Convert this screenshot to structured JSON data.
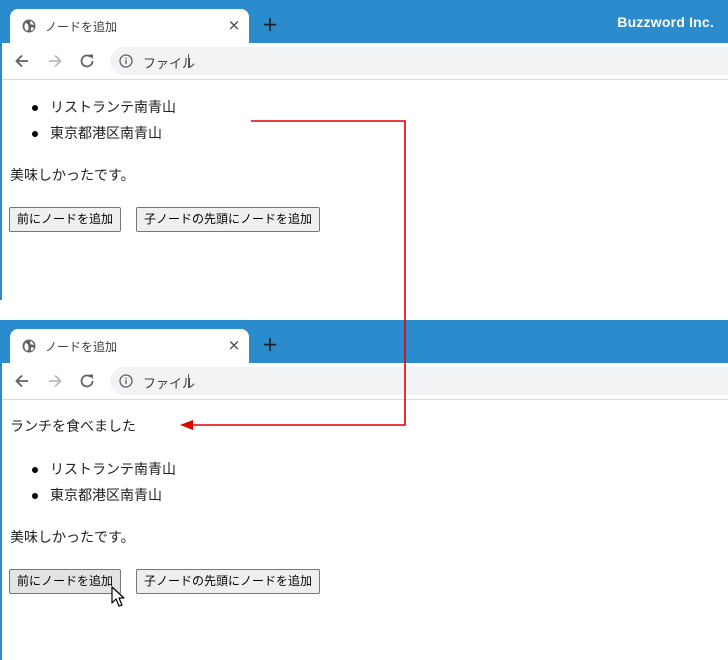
{
  "tab": {
    "title": "ノードを追加",
    "close_icon": "×",
    "new_tab_icon": "+"
  },
  "brand": "Buzzword Inc.",
  "address_bar": {
    "scheme_label": "ファイル"
  },
  "before": {
    "list_items": [
      "リストランテ南青山",
      "東京都港区南青山"
    ],
    "paragraph": "美味しかったです。",
    "buttons": {
      "insert_before": "前にノードを追加",
      "prepend_child": "子ノードの先頭にノードを追加"
    }
  },
  "after": {
    "inserted_paragraph": "ランチを食べました",
    "list_items": [
      "リストランテ南青山",
      "東京都港区南青山"
    ],
    "paragraph": "美味しかったです。",
    "buttons": {
      "insert_before": "前にノードを追加",
      "prepend_child": "子ノードの先頭にノードを追加"
    }
  },
  "colors": {
    "tabstrip": "#2a8ccc",
    "annotation_arrow": "#e00000",
    "omnibox": "#f1f3f4"
  },
  "icons": [
    "globe-icon",
    "close-icon",
    "plus-icon",
    "back-arrow-icon",
    "forward-arrow-icon",
    "reload-icon",
    "info-icon",
    "mouse-cursor-icon"
  ]
}
